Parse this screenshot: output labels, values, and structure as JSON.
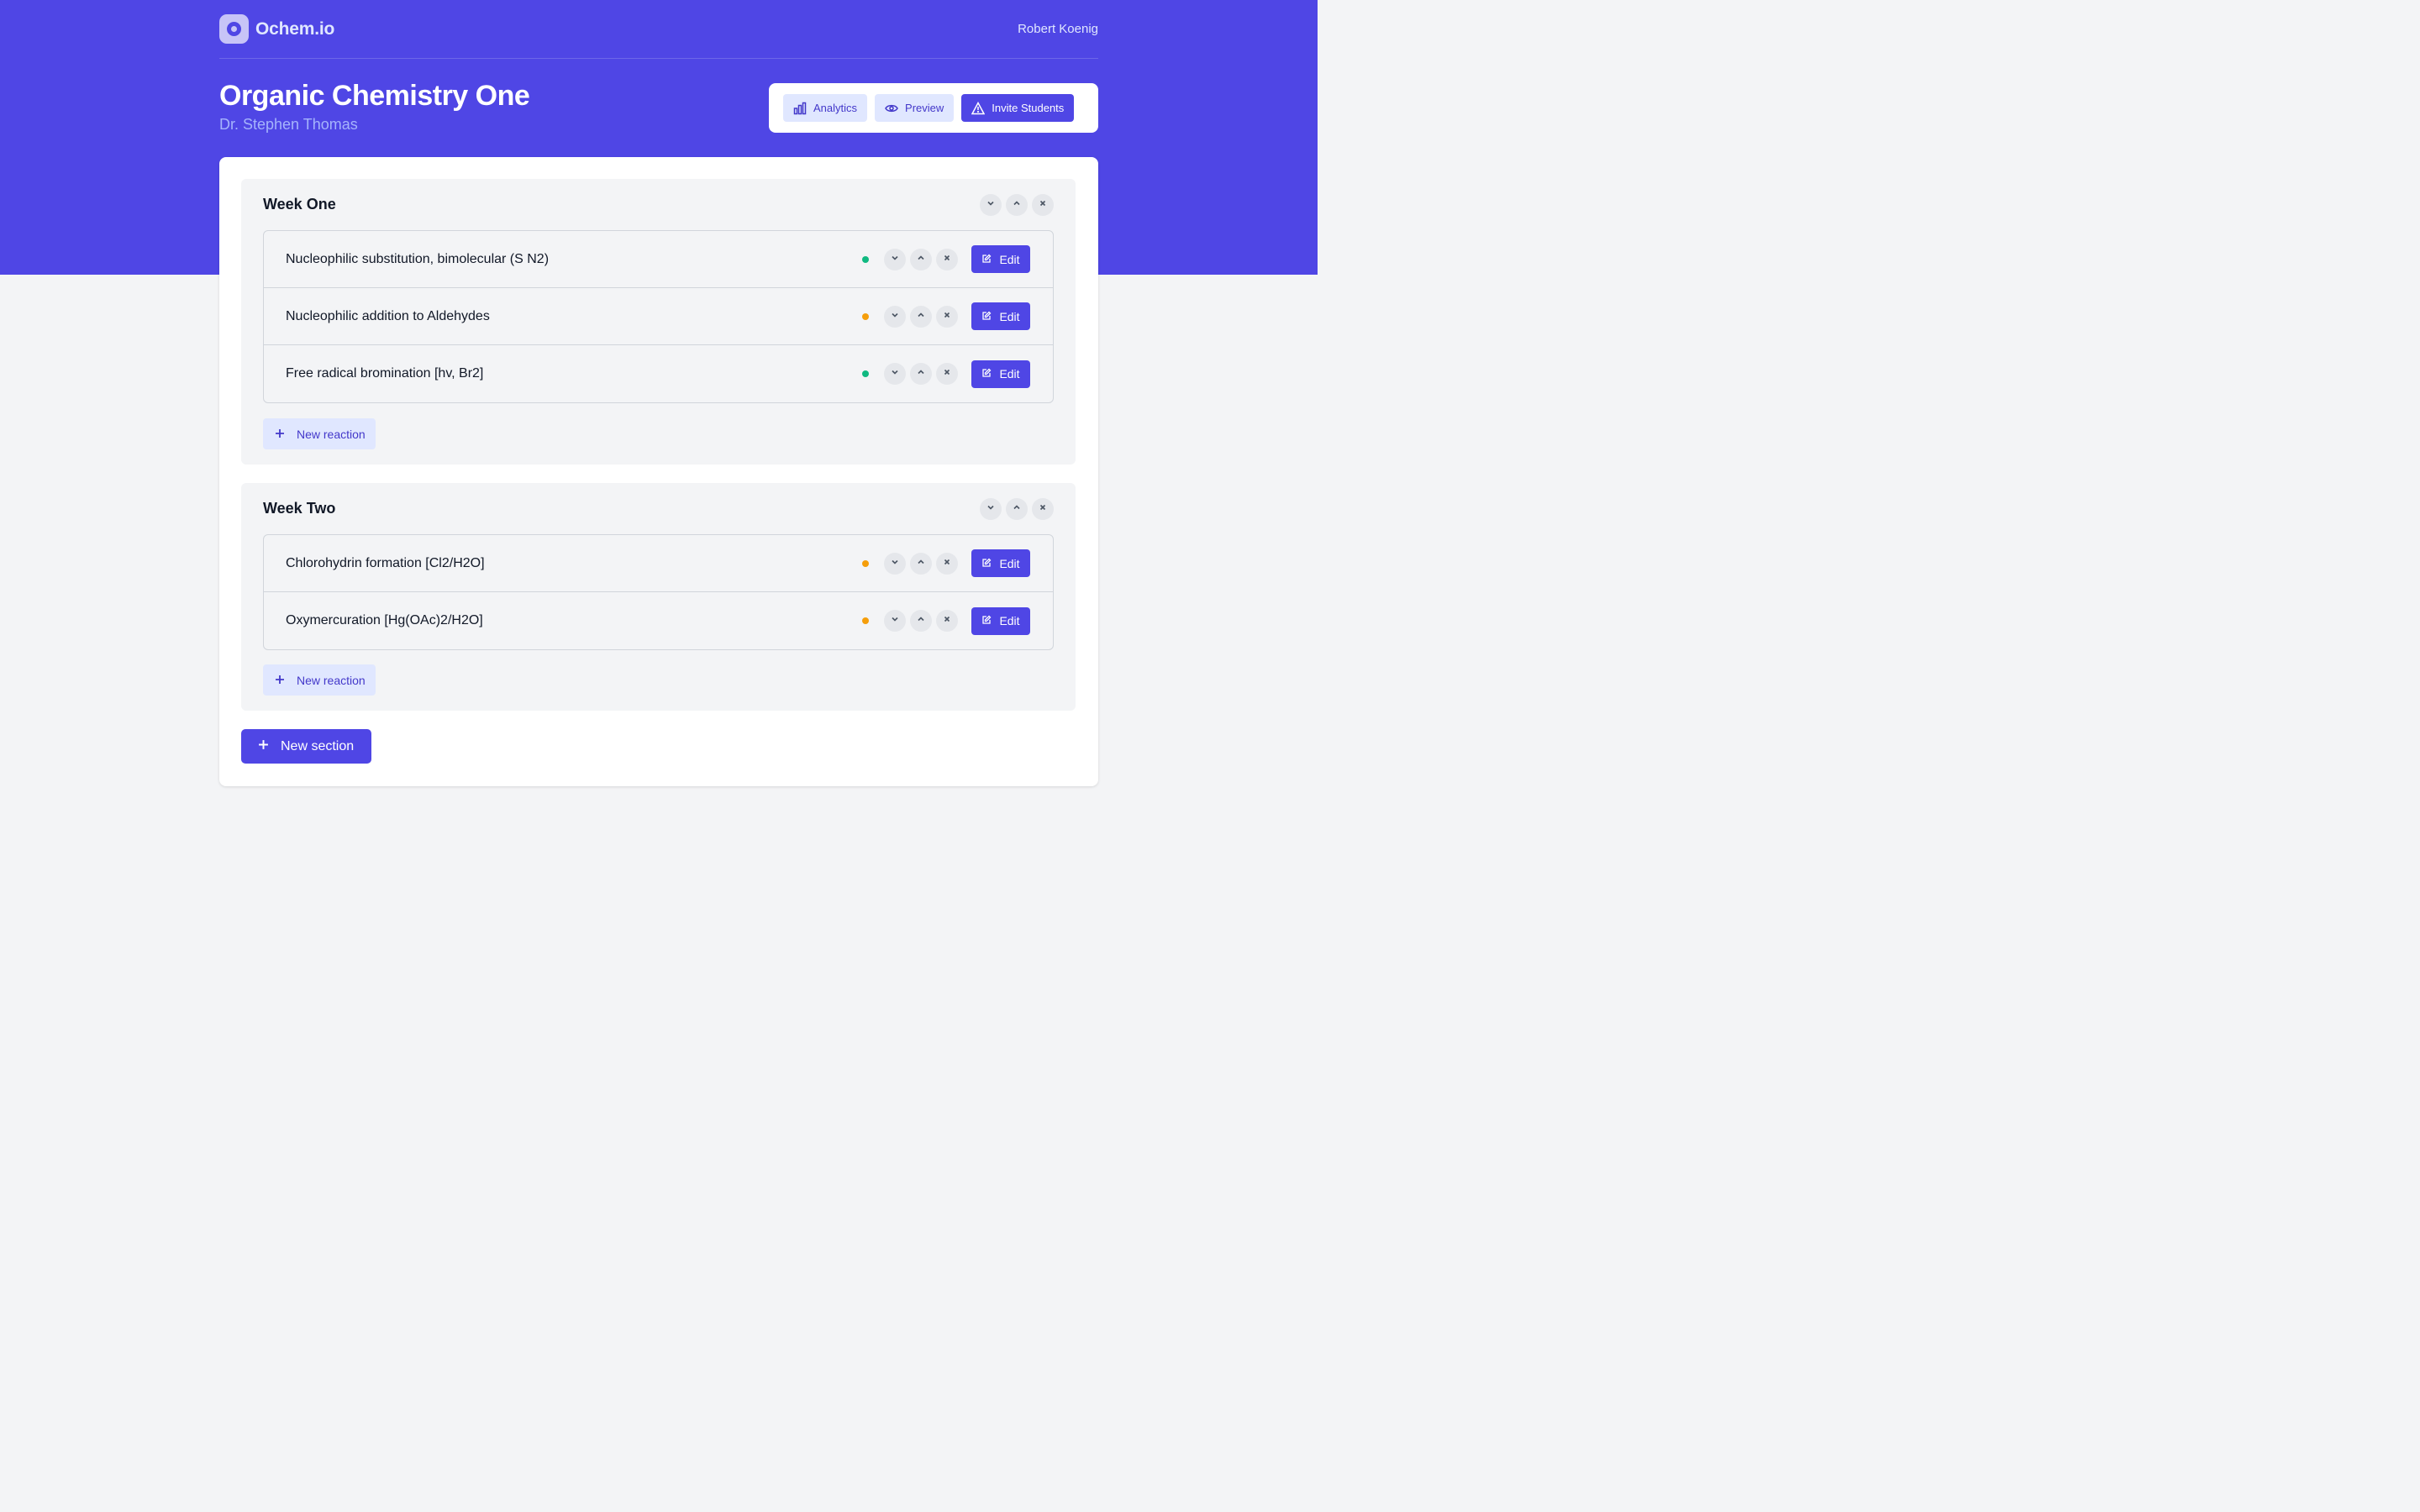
{
  "app": {
    "brand": "Ochem.io",
    "user": "Robert Koenig"
  },
  "course": {
    "title": "Organic Chemistry One",
    "instructor": "Dr. Stephen Thomas"
  },
  "actions": {
    "analytics": "Analytics",
    "preview": "Preview",
    "invite": "Invite Students"
  },
  "colors": {
    "primary": "#4f46e5",
    "status_ready": "#10b981",
    "status_draft": "#f59e0b"
  },
  "sections": [
    {
      "title": "Week One",
      "reactions": [
        {
          "name": "Nucleophilic substitution, bimolecular (S N2)",
          "status": "green",
          "edit": "Edit"
        },
        {
          "name": "Nucleophilic addition to Aldehydes",
          "status": "orange",
          "edit": "Edit"
        },
        {
          "name": "Free radical bromination [hv, Br2]",
          "status": "green",
          "edit": "Edit"
        }
      ],
      "new_reaction": "New reaction"
    },
    {
      "title": "Week Two",
      "reactions": [
        {
          "name": "Chlorohydrin formation [Cl2/H2O]",
          "status": "orange",
          "edit": "Edit"
        },
        {
          "name": "Oxymercuration [Hg(OAc)2/H2O]",
          "status": "orange",
          "edit": "Edit"
        }
      ],
      "new_reaction": "New reaction"
    }
  ],
  "new_section": "New section",
  "icons": {
    "analytics": "bar-chart-icon",
    "preview": "eye-icon",
    "invite": "triangle-icon",
    "edit": "pencil-square-icon",
    "move_down": "chevron-down-icon",
    "move_up": "chevron-up-icon",
    "remove": "close-icon",
    "add": "plus-icon"
  }
}
